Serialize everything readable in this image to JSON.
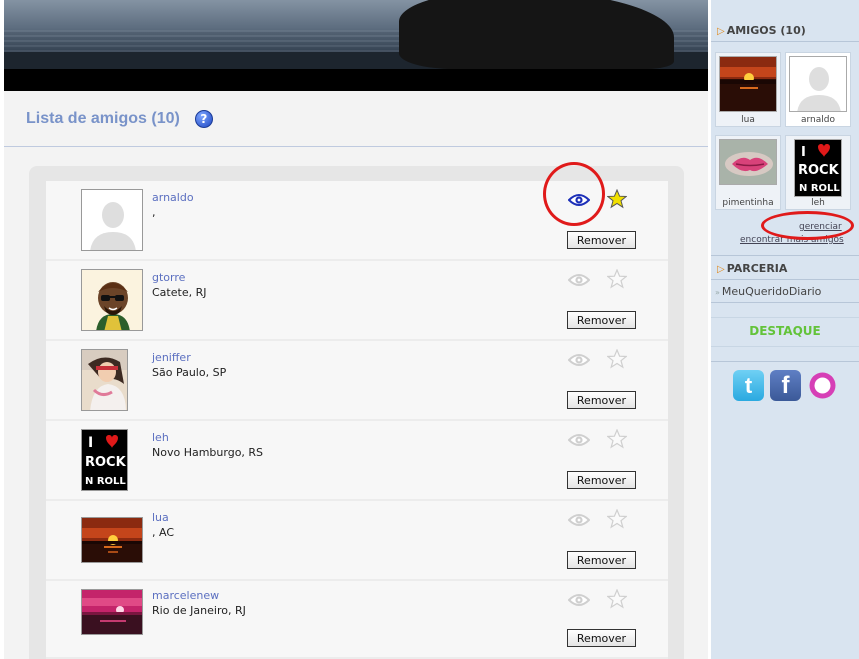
{
  "main": {
    "title": "Lista de amigos (10)",
    "help_icon": "help-icon",
    "friends": [
      {
        "name": "arnaldo",
        "location": ",",
        "eye_active": true,
        "star_active": true,
        "remove_label": "Remover",
        "avatar": "default-avatar"
      },
      {
        "name": "gtorre",
        "location": "Catete, RJ",
        "eye_active": false,
        "star_active": false,
        "remove_label": "Remover",
        "avatar": "cartoon-avatar"
      },
      {
        "name": "jeniffer",
        "location": "São Paulo, SP",
        "eye_active": false,
        "star_active": false,
        "remove_label": "Remover",
        "avatar": "photo-avatar"
      },
      {
        "name": "leh",
        "location": "Novo Hamburgo, RS",
        "eye_active": false,
        "star_active": false,
        "remove_label": "Remover",
        "avatar": "rock-n-roll-avatar"
      },
      {
        "name": "lua",
        "location": ", AC",
        "eye_active": false,
        "star_active": false,
        "remove_label": "Remover",
        "avatar": "sunset-avatar"
      },
      {
        "name": "marcelenew",
        "location": "Rio de Janeiro, RJ",
        "eye_active": false,
        "star_active": false,
        "remove_label": "Remover",
        "avatar": "pink-sunset-avatar"
      }
    ]
  },
  "sidebar": {
    "friends_header": "AMIGOS (10)",
    "thumbs": [
      {
        "name": "lua"
      },
      {
        "name": "arnaldo"
      },
      {
        "name": "pimentinha"
      },
      {
        "name": "leh"
      }
    ],
    "manage_link": "gerenciar",
    "find_link": "encontrar mais amigos",
    "partner_header": "PARCERIA",
    "partner_item": "MeuQueridoDiario",
    "featured_label": "DESTAQUE",
    "rock_text_1": "I",
    "rock_text_2": "ROCK",
    "rock_text_3": "N ROLL",
    "social": [
      {
        "icon": "twitter-icon",
        "glyph": "t",
        "color": "#2aa9e0"
      },
      {
        "icon": "facebook-icon",
        "glyph": "f",
        "color": "#3b5998"
      },
      {
        "icon": "orkut-icon",
        "glyph": "",
        "color": "#d63fb6"
      }
    ]
  },
  "colors": {
    "title": "#7993c9",
    "link": "#5b6fc0",
    "eye_active": "#1c2fb8",
    "star_active": "#f1e000",
    "icon_inactive": "#cfcfcf",
    "annotation": "#e01a1a",
    "featured": "#63c33a"
  }
}
